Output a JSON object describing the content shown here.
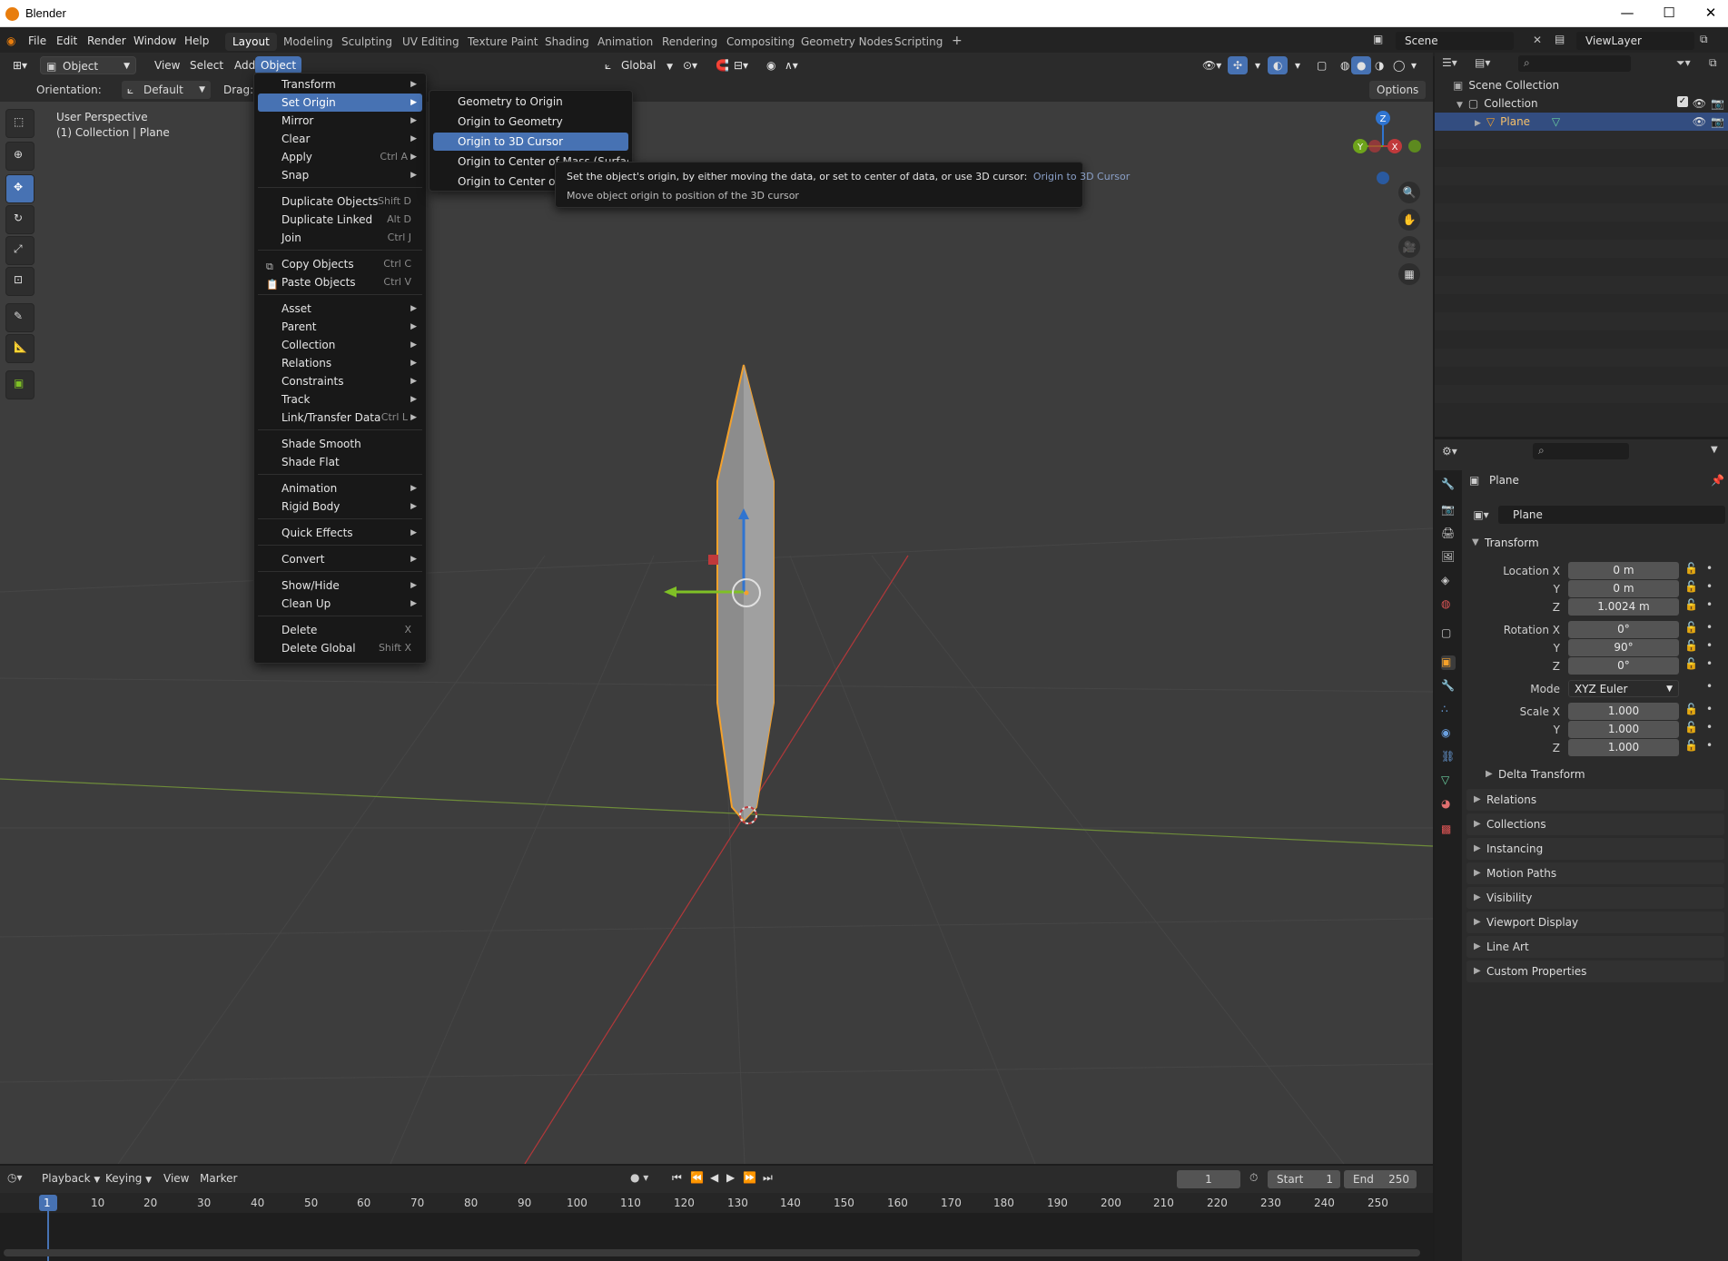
{
  "window": {
    "title": "Blender",
    "controls": [
      "—",
      "☐",
      "✕"
    ]
  },
  "topmenu": {
    "items": [
      "File",
      "Edit",
      "Render",
      "Window",
      "Help"
    ],
    "workspaces": [
      "Layout",
      "Modeling",
      "Sculpting",
      "UV Editing",
      "Texture Paint",
      "Shading",
      "Animation",
      "Rendering",
      "Compositing",
      "Geometry Nodes",
      "Scripting"
    ],
    "add_tab": "+",
    "scene": "Scene",
    "viewlayer": "ViewLayer"
  },
  "header": {
    "mode": "Object Mode",
    "menus": [
      "View",
      "Select",
      "Add",
      "Object"
    ],
    "transform_orientation": "Global",
    "orientation_label": "Orientation:",
    "orientation_value": "Default",
    "drag_label": "Drag:",
    "options": "Options"
  },
  "viewport": {
    "perspective": "User Perspective",
    "context": "(1) Collection | Plane"
  },
  "object_menu": {
    "items": [
      {
        "label": "Transform",
        "shortcut": "",
        "submenu": true
      },
      {
        "label": "Set Origin",
        "shortcut": "",
        "submenu": true
      },
      {
        "label": "Mirror",
        "shortcut": "",
        "submenu": true
      },
      {
        "label": "Clear",
        "shortcut": "",
        "submenu": true
      },
      {
        "label": "Apply",
        "shortcut": "Ctrl A",
        "submenu": true
      },
      {
        "label": "Snap",
        "shortcut": "",
        "submenu": true
      },
      {
        "label": "Duplicate Objects",
        "shortcut": "Shift D",
        "submenu": false
      },
      {
        "label": "Duplicate Linked",
        "shortcut": "Alt D",
        "submenu": false
      },
      {
        "label": "Join",
        "shortcut": "Ctrl J",
        "submenu": false
      },
      {
        "label": "Copy Objects",
        "shortcut": "Ctrl C",
        "submenu": false
      },
      {
        "label": "Paste Objects",
        "shortcut": "Ctrl V",
        "submenu": false
      },
      {
        "label": "Asset",
        "shortcut": "",
        "submenu": true
      },
      {
        "label": "Parent",
        "shortcut": "",
        "submenu": true
      },
      {
        "label": "Collection",
        "shortcut": "",
        "submenu": true
      },
      {
        "label": "Relations",
        "shortcut": "",
        "submenu": true
      },
      {
        "label": "Constraints",
        "shortcut": "",
        "submenu": true
      },
      {
        "label": "Track",
        "shortcut": "",
        "submenu": true
      },
      {
        "label": "Link/Transfer Data",
        "shortcut": "Ctrl L",
        "submenu": true
      },
      {
        "label": "Shade Smooth",
        "shortcut": "",
        "submenu": false
      },
      {
        "label": "Shade Flat",
        "shortcut": "",
        "submenu": false
      },
      {
        "label": "Animation",
        "shortcut": "",
        "submenu": true
      },
      {
        "label": "Rigid Body",
        "shortcut": "",
        "submenu": true
      },
      {
        "label": "Quick Effects",
        "shortcut": "",
        "submenu": true
      },
      {
        "label": "Convert",
        "shortcut": "",
        "submenu": true
      },
      {
        "label": "Show/Hide",
        "shortcut": "",
        "submenu": true
      },
      {
        "label": "Clean Up",
        "shortcut": "",
        "submenu": true
      },
      {
        "label": "Delete",
        "shortcut": "X",
        "submenu": false
      },
      {
        "label": "Delete Global",
        "shortcut": "Shift X",
        "submenu": false
      }
    ]
  },
  "set_origin_menu": {
    "items": [
      "Geometry to Origin",
      "Origin to Geometry",
      "Origin to 3D Cursor",
      "Origin to Center of Mass (Surface)",
      "Origin to Center of Ma"
    ]
  },
  "tooltip": {
    "description": "Set the object's origin, by either moving the data, or set to center of data, or use 3D cursor:",
    "operator": "Origin to 3D Cursor",
    "detail": "Move object origin to position of the 3D cursor"
  },
  "gizmo": {
    "z": "Z",
    "y": "Y",
    "x": "X"
  },
  "outliner": {
    "scene_collection": "Scene Collection",
    "collection": "Collection",
    "object": "Plane"
  },
  "properties": {
    "object_name": "Plane",
    "data_name": "Plane",
    "transform_header": "Transform",
    "location_label": "Location X",
    "location": [
      "0 m",
      "0 m",
      "1.0024 m"
    ],
    "rotation_label": "Rotation X",
    "rotation": [
      "0°",
      "90°",
      "0°"
    ],
    "mode_label": "Mode",
    "mode": "XYZ Euler",
    "scale_label": "Scale X",
    "scale": [
      "1.000",
      "1.000",
      "1.000"
    ],
    "axis_y": "Y",
    "axis_z": "Z",
    "delta": "Delta Transform",
    "sections": [
      "Relations",
      "Collections",
      "Instancing",
      "Motion Paths",
      "Visibility",
      "Viewport Display",
      "Line Art",
      "Custom Properties"
    ]
  },
  "timeline": {
    "menus": [
      "Playback",
      "Keying",
      "View",
      "Marker"
    ],
    "current_frame": "1",
    "start_label": "Start",
    "start": "1",
    "end_label": "End",
    "end": "250",
    "ticks": [
      "1",
      "10",
      "20",
      "30",
      "40",
      "50",
      "60",
      "70",
      "80",
      "90",
      "100",
      "110",
      "120",
      "130",
      "140",
      "150",
      "160",
      "170",
      "180",
      "190",
      "200",
      "210",
      "220",
      "230",
      "240",
      "250"
    ]
  },
  "colors": {
    "accent": "#4772b3",
    "selection": "#f5a12a",
    "x_axis": "#c0393b",
    "y_axis": "#6ea31b",
    "z_axis": "#2f74d0"
  }
}
